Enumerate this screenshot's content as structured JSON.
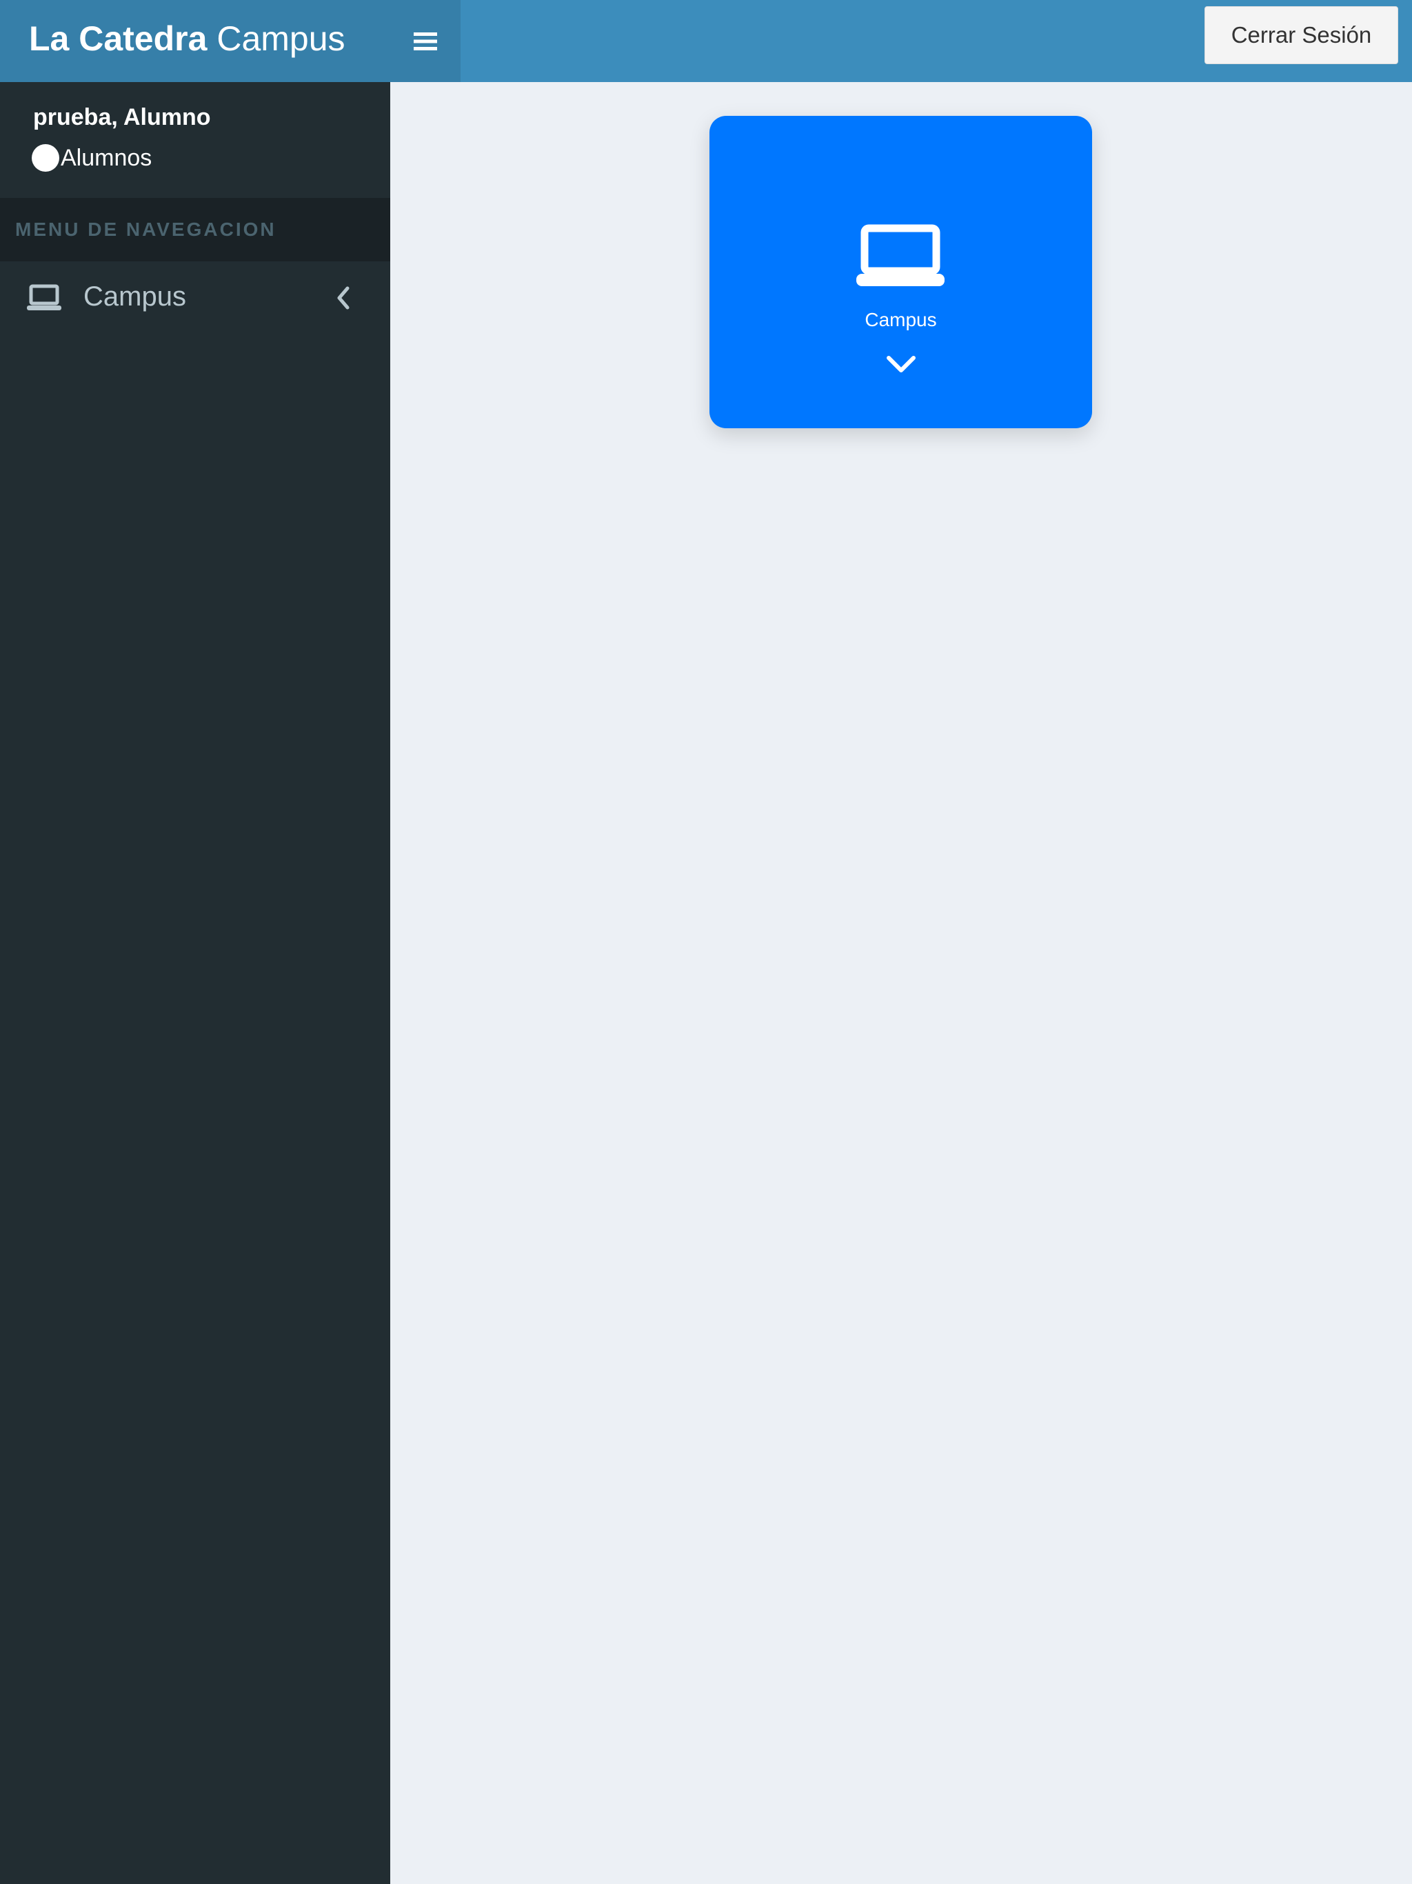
{
  "header": {
    "logo_strong": "La Catedra",
    "logo_light": " Campus",
    "logout_label": "Cerrar Sesión"
  },
  "sidebar": {
    "user_name": "prueba, Alumno",
    "user_role": "Alumnos",
    "nav_header": "MENU DE NAVEGACION",
    "items": [
      {
        "label": "Campus",
        "icon": "laptop-icon"
      }
    ]
  },
  "main": {
    "tiles": [
      {
        "label": "Campus",
        "icon": "laptop-icon"
      }
    ]
  },
  "colors": {
    "header": "#3c8dbc",
    "logo_bg": "#367fa9",
    "sidebar": "#222d32",
    "sidebar_header": "#1a2226",
    "content_bg": "#ecf0f5",
    "tile": "#0077ff"
  }
}
